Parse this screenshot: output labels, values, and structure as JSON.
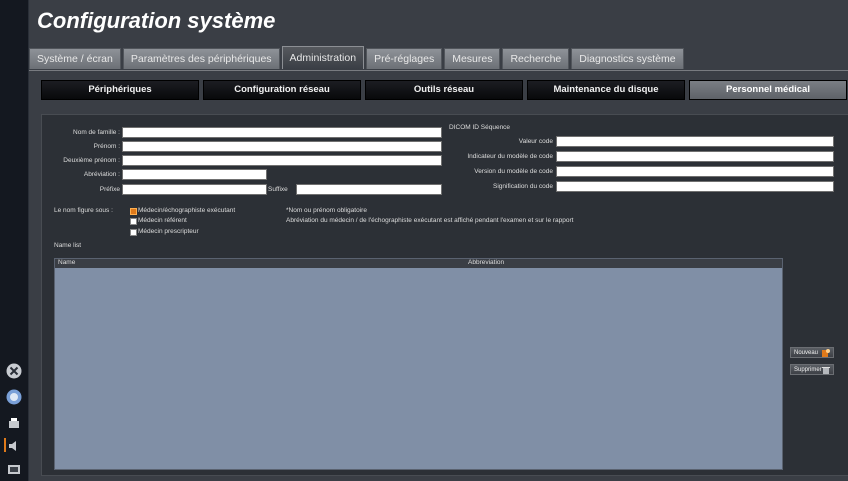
{
  "window": {
    "title": "Configuration système"
  },
  "tabs": [
    {
      "label": "Système / écran",
      "active": false
    },
    {
      "label": "Paramètres des périphériques",
      "active": false
    },
    {
      "label": "Administration",
      "active": true
    },
    {
      "label": "Pré-réglages",
      "active": false
    },
    {
      "label": "Mesures",
      "active": false
    },
    {
      "label": "Recherche",
      "active": false
    },
    {
      "label": "Diagnostics système",
      "active": false
    }
  ],
  "subtabs": [
    {
      "label": "Périphériques",
      "active": false
    },
    {
      "label": "Configuration réseau",
      "active": false
    },
    {
      "label": "Outils réseau",
      "active": false
    },
    {
      "label": "Maintenance du disque",
      "active": false
    },
    {
      "label": "Personnel médical",
      "active": true
    }
  ],
  "form": {
    "last_name_label": "Nom de famille :",
    "first_name_label": "Prénom :",
    "middle_name_label": "Deuxième prénom :",
    "abbrev_label": "Abréviation :",
    "prefix_label": "Préfixe",
    "suffix_label": "Suffixe",
    "last_name_value": "",
    "first_name_value": "",
    "middle_name_value": "",
    "abbrev_value": "",
    "prefix_value": "",
    "suffix_value": ""
  },
  "dicom": {
    "section_label": "DICOM ID Séquence",
    "code_value_label": "Valeur code",
    "coding_scheme_label": "Indicateur du modèle de code",
    "scheme_version_label": "Version du modèle de code",
    "code_meaning_label": "Signification du code",
    "code_value": "",
    "coding_scheme": "",
    "scheme_version": "",
    "code_meaning": ""
  },
  "appears_as": {
    "label": "Le nom figure sous :",
    "options": [
      {
        "label": "Médecin/échographiste exécutant",
        "checked": true
      },
      {
        "label": "Médecin référent",
        "checked": false
      },
      {
        "label": "Médecin prescripteur",
        "checked": false
      }
    ]
  },
  "notes": {
    "required": "*Nom ou prénom obligatoire",
    "abbrev_note": "Abréviation du médecin / de l'échographiste exécutant est affiché pendant l'examen et sur le rapport"
  },
  "name_list": {
    "title": "Name list",
    "columns": [
      "Name",
      "Abbreviation"
    ],
    "rows": []
  },
  "buttons": {
    "new": "Nouveau",
    "delete": "Supprimer"
  },
  "colors": {
    "accent": "#e07a1a",
    "list_bg": "#808fa6",
    "panel_bg": "#2c3036"
  },
  "icons": {
    "new": "new-user-icon",
    "delete": "delete-icon"
  }
}
